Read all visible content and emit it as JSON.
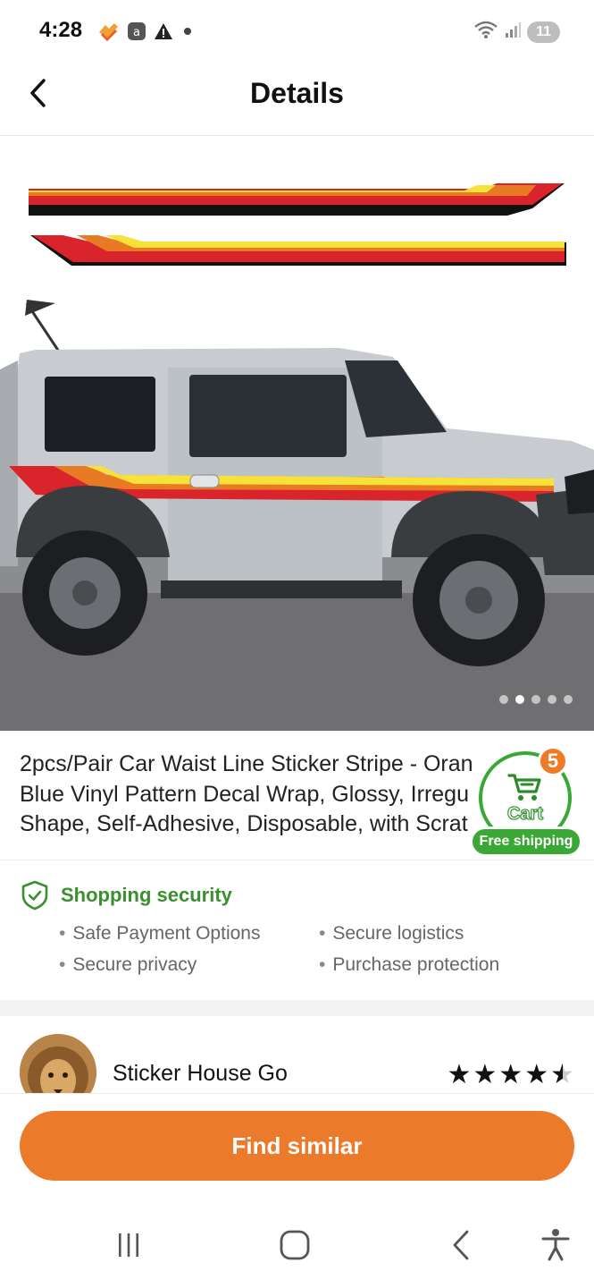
{
  "status_bar": {
    "time": "4:28",
    "battery": "11",
    "left_icons": [
      "app-notification-icon",
      "app-icon",
      "warning-icon",
      "dot-icon"
    ],
    "right_icons": [
      "wifi-icon",
      "signal-icon",
      "battery-icon"
    ]
  },
  "header": {
    "title": "Details",
    "back_icon": "chevron-left-icon"
  },
  "gallery": {
    "image_count": 5,
    "active_index": 1
  },
  "product": {
    "title": "2pcs/Pair Car Waist Line Sticker Stripe - Oran\nBlue Vinyl Pattern Decal Wrap, Glossy, Irregu\nShape, Self-Adhesive, Disposable, with Scrat"
  },
  "cart": {
    "label": "Cart",
    "count": "5",
    "free_shipping": "Free shipping",
    "icon": "cart-icon"
  },
  "security": {
    "title": "Shopping security",
    "icon": "shield-check-icon",
    "items": [
      "Safe Payment Options",
      "Secure logistics",
      "Secure privacy",
      "Purchase protection"
    ]
  },
  "seller": {
    "name": "Sticker House Go",
    "rating_stars": 4.5
  },
  "actions": {
    "find_similar": "Find similar"
  },
  "nav": {
    "recents_icon": "recents-icon",
    "home_icon": "home-icon",
    "back_icon": "back-icon",
    "accessibility_icon": "accessibility-icon"
  },
  "colors": {
    "accent_orange": "#ec7a2b",
    "security_green": "#3a8f2e",
    "cart_green": "#3aa835"
  }
}
